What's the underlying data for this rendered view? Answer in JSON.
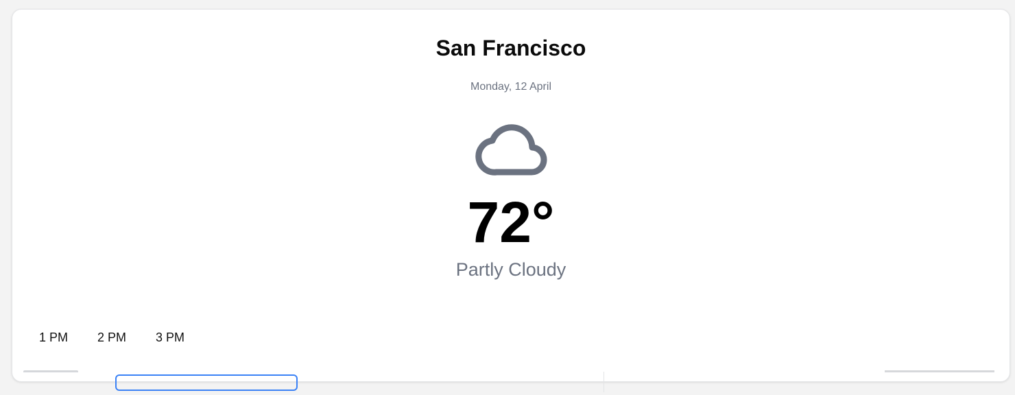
{
  "weather": {
    "city": "San Francisco",
    "date": "Monday, 12 April",
    "icon": "cloud-icon",
    "temperature": "72°",
    "condition": "Partly Cloudy",
    "icon_color": "#6b7280"
  },
  "hourly": {
    "hours": [
      "1 PM",
      "2 PM",
      "3 PM"
    ]
  }
}
